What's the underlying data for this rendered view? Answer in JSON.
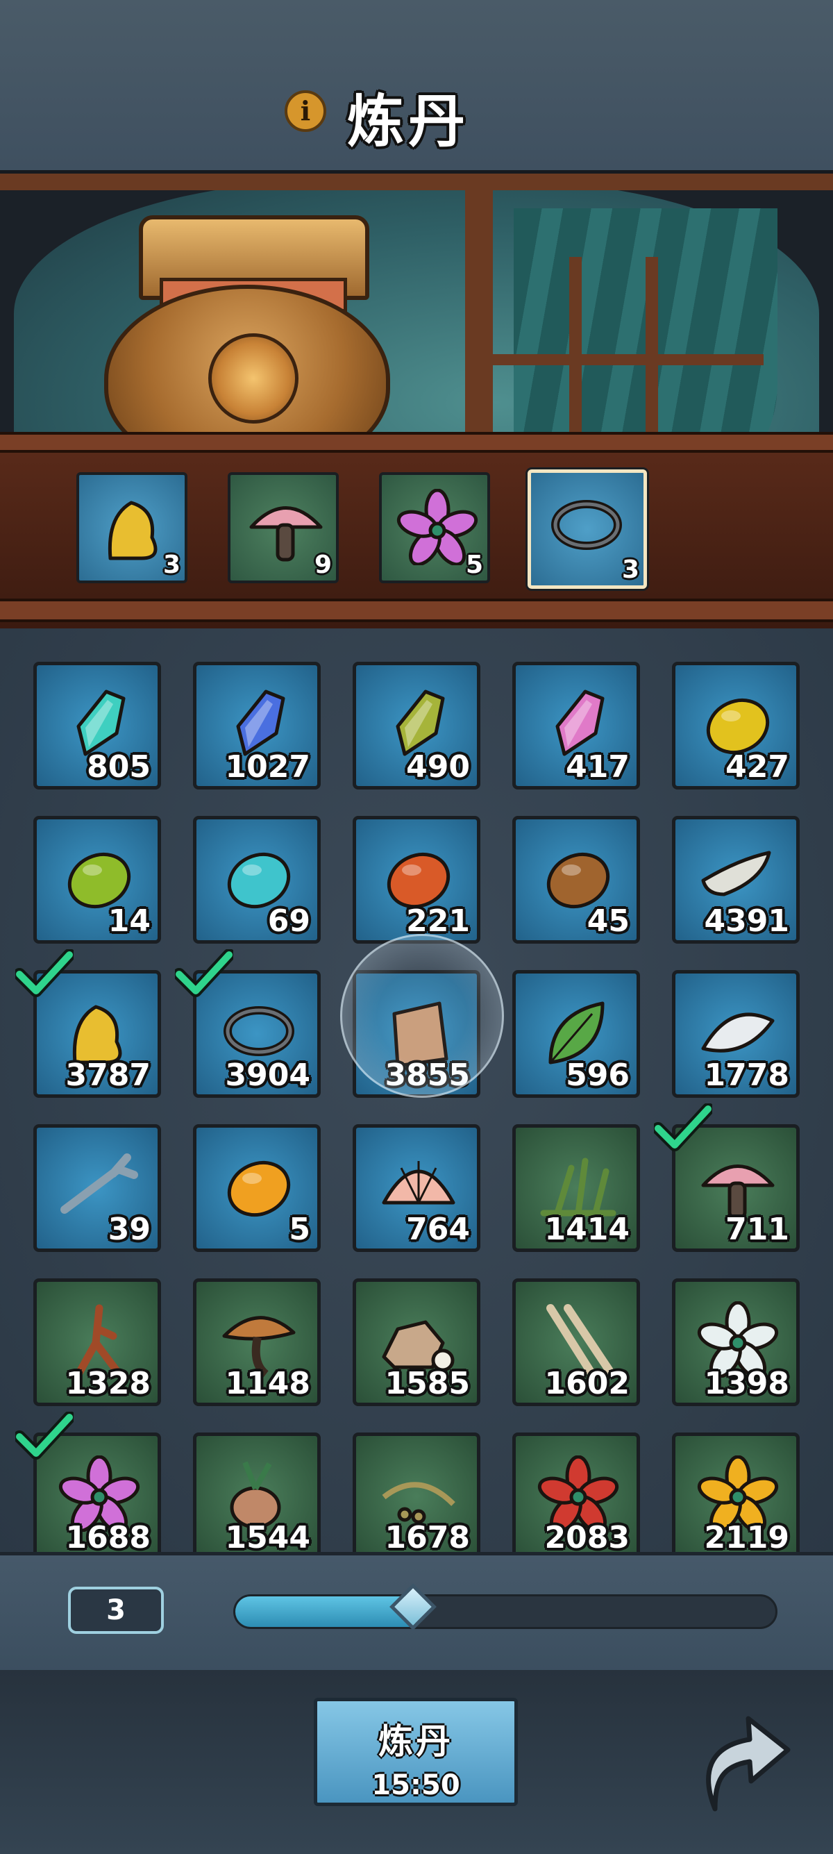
{
  "header": {
    "title": "炼丹",
    "info_icon": "info-icon"
  },
  "furnace_slots": [
    {
      "item": "yellow-resin",
      "count": "3",
      "bg": "blue",
      "selected": false
    },
    {
      "item": "pink-mushroom",
      "count": "9",
      "bg": "green",
      "selected": false
    },
    {
      "item": "purple-flower",
      "count": "5",
      "bg": "green",
      "selected": false
    },
    {
      "item": "coiled-rope",
      "count": "3",
      "bg": "blue",
      "selected": true
    }
  ],
  "inventory": [
    {
      "item": "teal-crystal",
      "count": "805",
      "bg": "blue",
      "checked": false,
      "color": "#3fcfc0"
    },
    {
      "item": "blue-crystal",
      "count": "1027",
      "bg": "blue",
      "checked": false,
      "color": "#4a6fe0"
    },
    {
      "item": "olive-crystal",
      "count": "490",
      "bg": "blue",
      "checked": false,
      "color": "#a6b43a"
    },
    {
      "item": "pink-crystal",
      "count": "417",
      "bg": "blue",
      "checked": false,
      "color": "#e07ac8"
    },
    {
      "item": "yellow-stone",
      "count": "427",
      "bg": "blue",
      "checked": false,
      "color": "#e2c21e"
    },
    {
      "item": "green-stone",
      "count": "14",
      "bg": "blue",
      "checked": false,
      "color": "#8fbc2a"
    },
    {
      "item": "cyan-stone",
      "count": "69",
      "bg": "blue",
      "checked": false,
      "color": "#3fc4cc"
    },
    {
      "item": "orange-stone",
      "count": "221",
      "bg": "blue",
      "checked": false,
      "color": "#d95a28"
    },
    {
      "item": "brown-stone",
      "count": "45",
      "bg": "blue",
      "checked": false,
      "color": "#a0642e"
    },
    {
      "item": "white-horn",
      "count": "4391",
      "bg": "blue",
      "checked": false,
      "color": "#e0e0d8"
    },
    {
      "item": "yellow-resin",
      "count": "3787",
      "bg": "blue",
      "checked": true,
      "color": "#e8be30"
    },
    {
      "item": "coiled-rope",
      "count": "3904",
      "bg": "blue",
      "checked": true,
      "color": "#222a30"
    },
    {
      "item": "ancient-scroll",
      "count": "3855",
      "bg": "blue",
      "checked": false,
      "color": "#c89a78"
    },
    {
      "item": "green-leaf",
      "count": "596",
      "bg": "blue",
      "checked": false,
      "color": "#58a846"
    },
    {
      "item": "white-feather",
      "count": "1778",
      "bg": "blue",
      "checked": false,
      "color": "#e8ecef"
    },
    {
      "item": "bone-branch",
      "count": "39",
      "bg": "blue",
      "checked": false,
      "color": "#8aa0b0"
    },
    {
      "item": "amber-gem",
      "count": "5",
      "bg": "blue",
      "checked": false,
      "color": "#f0a020"
    },
    {
      "item": "seashell",
      "count": "764",
      "bg": "blue",
      "checked": false,
      "color": "#f2b8a8"
    },
    {
      "item": "green-herb",
      "count": "1414",
      "bg": "green",
      "checked": false,
      "color": "#5f8a3a"
    },
    {
      "item": "pink-mushroom",
      "count": "711",
      "bg": "green",
      "checked": true,
      "color": "#e8a0b0"
    },
    {
      "item": "ginseng-root",
      "count": "1328",
      "bg": "green",
      "checked": false,
      "color": "#a04a28"
    },
    {
      "item": "lingzhi-mushroom",
      "count": "1148",
      "bg": "green",
      "checked": false,
      "color": "#c07a3c"
    },
    {
      "item": "rock-pearl",
      "count": "1585",
      "bg": "green",
      "checked": false,
      "color": "#c8a88a"
    },
    {
      "item": "dry-twigs",
      "count": "1602",
      "bg": "green",
      "checked": false,
      "color": "#d8c8a8"
    },
    {
      "item": "white-lotus",
      "count": "1398",
      "bg": "green",
      "checked": false,
      "color": "#e8f0f0"
    },
    {
      "item": "purple-flower",
      "count": "1688",
      "bg": "green",
      "checked": true,
      "color": "#d070d8"
    },
    {
      "item": "taro-bulb",
      "count": "1544",
      "bg": "green",
      "checked": false,
      "color": "#c08868"
    },
    {
      "item": "vine-seeds",
      "count": "1678",
      "bg": "green",
      "checked": false,
      "color": "#a89858"
    },
    {
      "item": "red-lily",
      "count": "2083",
      "bg": "green",
      "checked": false,
      "color": "#d03a30"
    },
    {
      "item": "golden-flower",
      "count": "2119",
      "bg": "green",
      "checked": false,
      "color": "#f0b020"
    }
  ],
  "slider": {
    "value": "3",
    "fill_fraction": 0.33
  },
  "footer": {
    "brew_label": "炼丹",
    "brew_timer": "15:50",
    "return_icon": "return-arrow-icon"
  },
  "colors": {
    "accent_blue": "#4a95c0",
    "check_green": "#2fd48c"
  }
}
